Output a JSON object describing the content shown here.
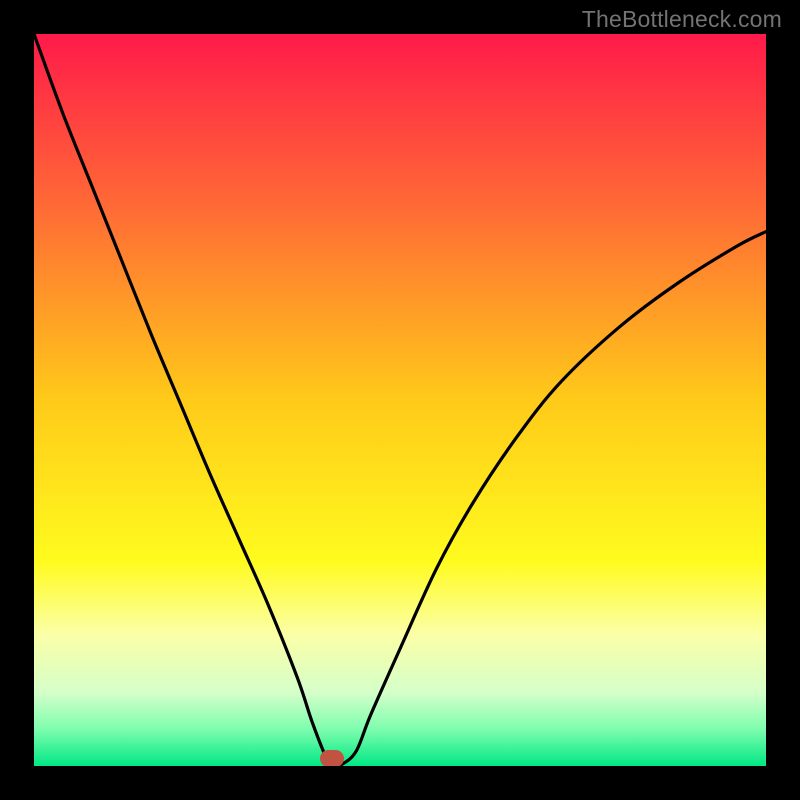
{
  "watermark": "TheBottleneck.com",
  "chart_data": {
    "type": "line",
    "title": "",
    "xlabel": "",
    "ylabel": "",
    "xlim": [
      0,
      100
    ],
    "ylim": [
      0,
      100
    ],
    "gradient_stops": [
      {
        "offset": 0.0,
        "color": "#ff1a4a"
      },
      {
        "offset": 0.25,
        "color": "#ff6f34"
      },
      {
        "offset": 0.5,
        "color": "#ffca19"
      },
      {
        "offset": 0.72,
        "color": "#fffb1e"
      },
      {
        "offset": 0.82,
        "color": "#fbffa7"
      },
      {
        "offset": 0.9,
        "color": "#d4ffc9"
      },
      {
        "offset": 0.95,
        "color": "#7dfdae"
      },
      {
        "offset": 1.0,
        "color": "#00e884"
      }
    ],
    "series": [
      {
        "name": "curve",
        "color": "#000000",
        "x": [
          0,
          4,
          8,
          12,
          16,
          20,
          24,
          28,
          32,
          36,
          38,
          40,
          41,
          42,
          44,
          46,
          50,
          55,
          60,
          66,
          72,
          80,
          88,
          96,
          100
        ],
        "y": [
          100,
          89,
          79,
          69,
          59,
          49.5,
          40,
          31,
          22,
          12,
          6,
          1,
          0.2,
          0.2,
          2,
          7,
          16,
          27,
          36,
          45,
          52.5,
          60,
          66,
          71,
          73
        ]
      }
    ],
    "marker": {
      "x": 41,
      "y": 0.3,
      "color": "#c15343"
    }
  }
}
